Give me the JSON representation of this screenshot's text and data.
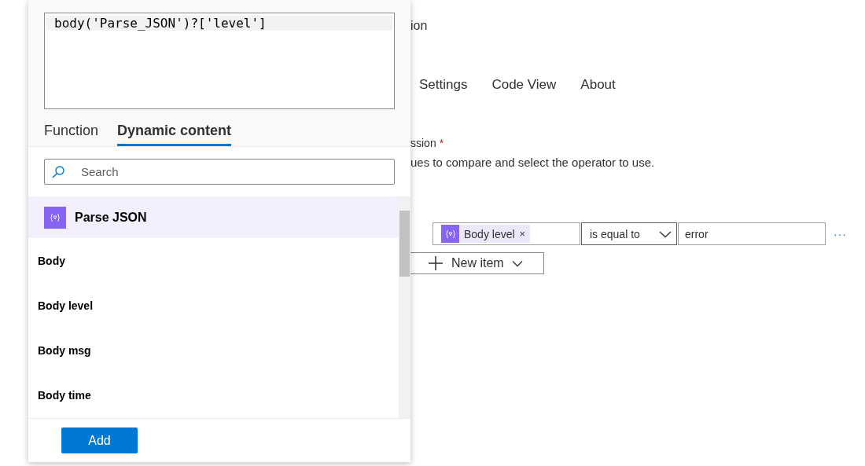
{
  "page": {
    "title_fragment": "ion",
    "tabs": [
      {
        "label": "Settings",
        "selected": false
      },
      {
        "label": "Code View",
        "selected": false
      },
      {
        "label": "About",
        "selected": false
      }
    ],
    "field_label": "ssion",
    "required_marker": "*",
    "description": "ues to compare and select the operator to use.",
    "condition": {
      "token": {
        "label": "Body level",
        "remove": "×"
      },
      "operator": "is equal to",
      "value": "error",
      "more": "···"
    },
    "new_item_button": "New item"
  },
  "popup": {
    "expression": "body('Parse_JSON')?['level']",
    "tabs": [
      {
        "label": "Function",
        "selected": false
      },
      {
        "label": "Dynamic content",
        "selected": true
      }
    ],
    "search": {
      "placeholder": "Search"
    },
    "group": {
      "title": "Parse JSON",
      "items": [
        {
          "label": "Body"
        },
        {
          "label": "Body level"
        },
        {
          "label": "Body msg"
        },
        {
          "label": "Body time"
        }
      ]
    },
    "add_button": "Add"
  }
}
